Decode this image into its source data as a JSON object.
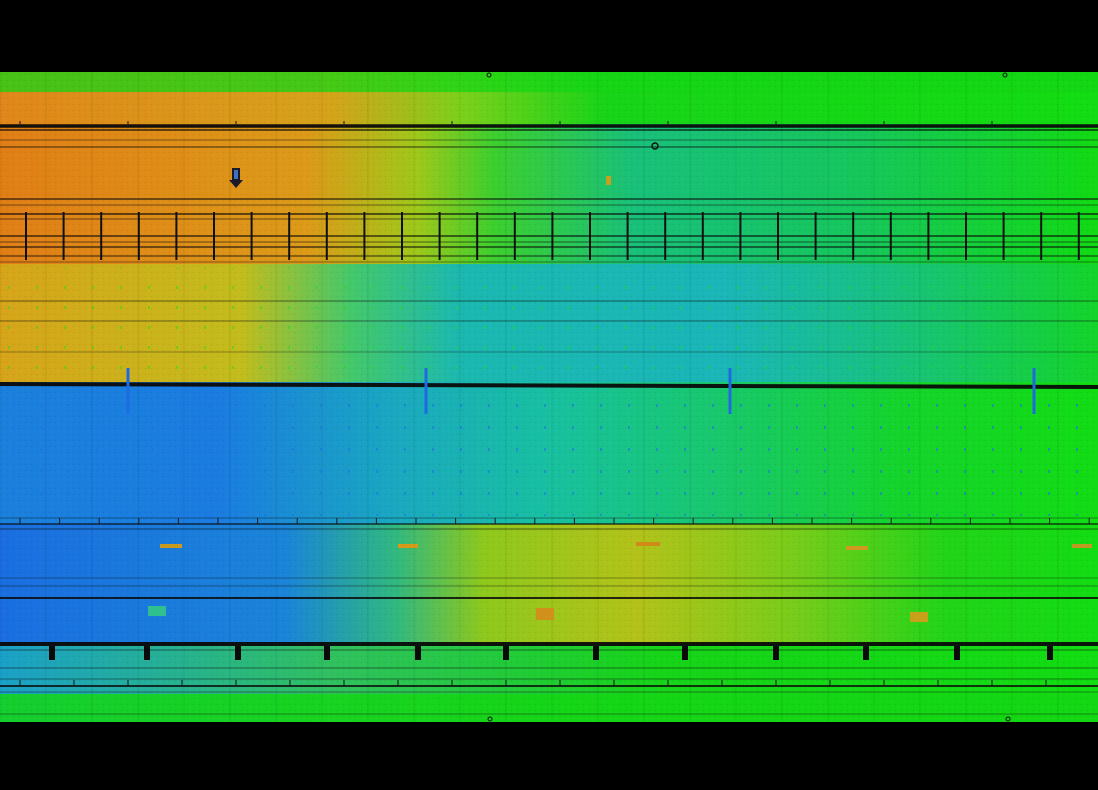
{
  "colors": {
    "background": "#000000",
    "orange": "#e08a1a",
    "yellow": "#b8c21a",
    "green": "#14d414",
    "teal": "#19bfae",
    "blue": "#1a78e0",
    "line": "#0a0a0a"
  }
}
